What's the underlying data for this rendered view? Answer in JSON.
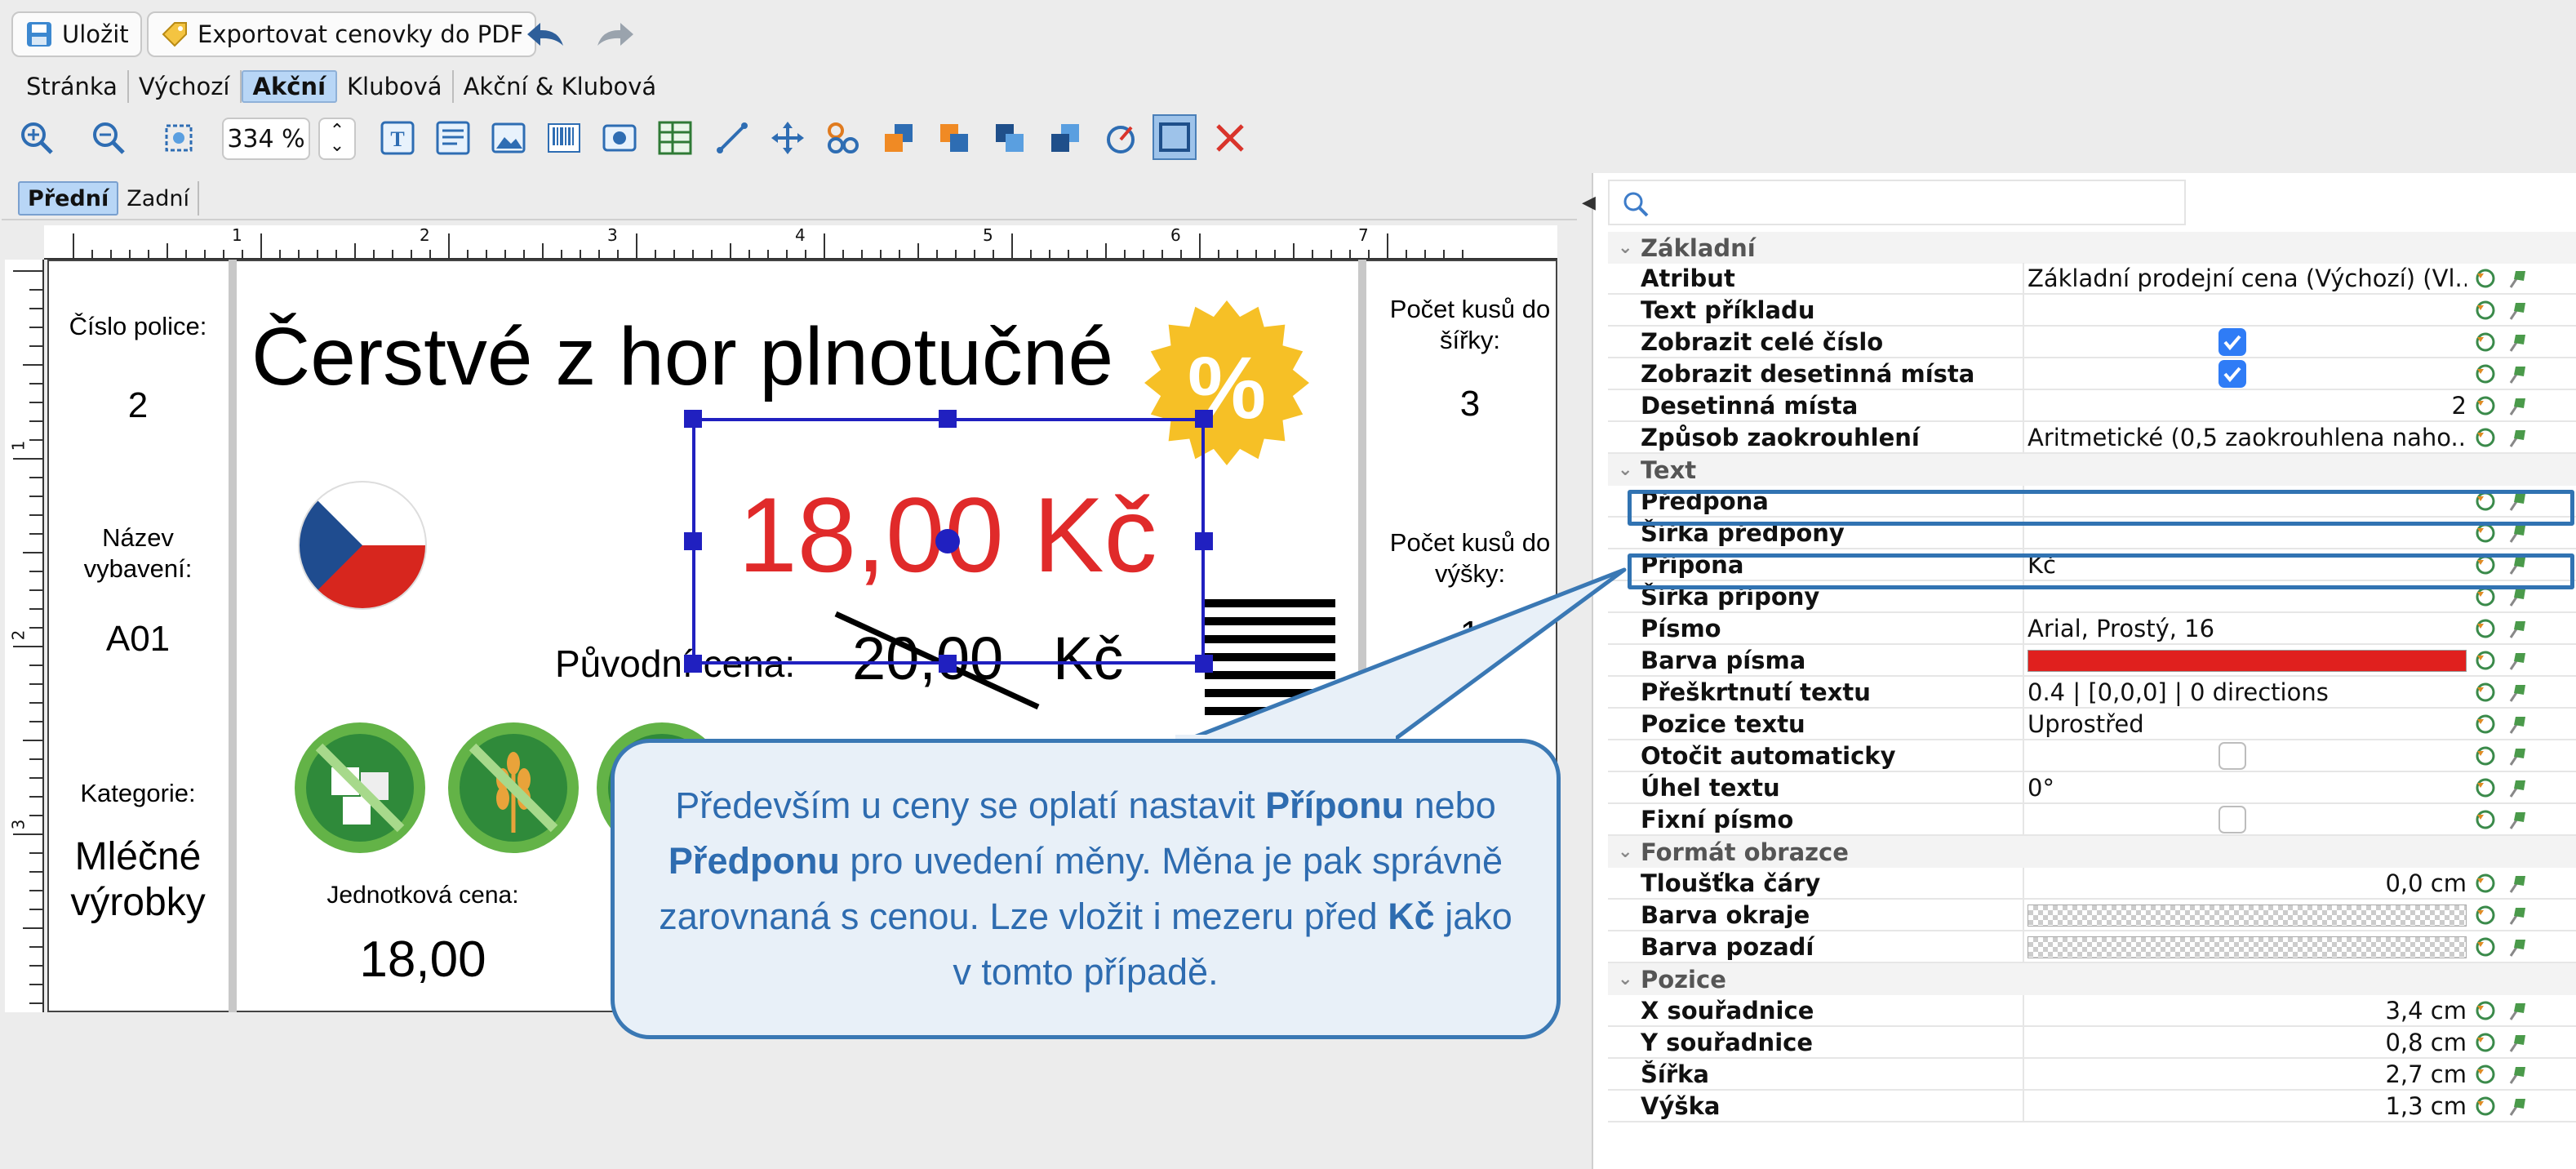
{
  "toolbar": {
    "save_label": "Uložit",
    "export_label": "Exportovat cenovky do PDF",
    "zoom_value": "334 %"
  },
  "tabs": [
    "Stránka",
    "Výchozí",
    "Akční",
    "Klubová",
    "Akční & Klubová"
  ],
  "active_tab": "Akční",
  "subtabs": [
    "Přední",
    "Zadní"
  ],
  "ruler": {
    "top_marks": [
      "1",
      "2",
      "3",
      "4",
      "5",
      "6",
      "7"
    ],
    "left_marks": [
      "1",
      "2",
      "3"
    ]
  },
  "label": {
    "shelf_label": "Číslo police:",
    "shelf_value": "2",
    "equipment_label": "Název vybavení:",
    "equipment_value": "A01",
    "category_label": "Kategorie:",
    "category_value": "Mléčné výrobky",
    "title": "Čerstvé z hor plnotučné",
    "badge": "%",
    "price": "18,00 Kč",
    "original_label": "Původní cena:",
    "original_value": "20,00",
    "original_currency": "Kč",
    "unit_label": "Jednotková cena:",
    "unit_value": "18,00",
    "width_count_label": "Počet kusů do šířky:",
    "width_count_value": "3",
    "height_count_label": "Počet kusů do výšky:",
    "height_count_value": "1"
  },
  "callout": {
    "t1": "Především u ceny se oplatí nastavit ",
    "b1": "Příponu",
    "t2": " nebo ",
    "b2": "Předponu",
    "t3": " pro uvedení měny. Měna je pak správně zarovnaná s cenou. Lze vložit i mezeru před ",
    "b3": "Kč",
    "t4": " jako v tomto případě."
  },
  "properties": {
    "sections": {
      "basic": "Základní",
      "text": "Text",
      "format": "Formát obrazce",
      "position": "Pozice"
    },
    "rows": {
      "attribute": {
        "key": "Atribut",
        "value": "Základní prodejní cena (Výchozí) (Vl..."
      },
      "sample": {
        "key": "Text příkladu",
        "value": ""
      },
      "whole": {
        "key": "Zobrazit celé číslo",
        "checked": true
      },
      "decimals_show": {
        "key": "Zobrazit desetinná místa",
        "checked": true
      },
      "decimals": {
        "key": "Desetinná místa",
        "value": "2"
      },
      "rounding": {
        "key": "Způsob zaokrouhlení",
        "value": "Aritmetické (0,5 zaokrouhlena naho..."
      },
      "prefix": {
        "key": "Předpona",
        "value": ""
      },
      "prefix_width": {
        "key": "Šířka předpony",
        "value": ""
      },
      "suffix": {
        "key": "Přípona",
        "value": " Kč"
      },
      "suffix_width": {
        "key": "Šířka přípony",
        "value": ""
      },
      "font": {
        "key": "Písmo",
        "value": "Arial, Prostý, 16"
      },
      "font_color": {
        "key": "Barva písma",
        "color": "#e0201e"
      },
      "strike": {
        "key": "Přeškrtnutí textu",
        "value": "0.4 | [0,0,0] | 0 directions"
      },
      "text_pos": {
        "key": "Pozice textu",
        "value": "Uprostřed"
      },
      "auto_rotate": {
        "key": "Otočit automaticky",
        "checked": false
      },
      "angle": {
        "key": "Úhel textu",
        "value": "0°"
      },
      "fixed_font": {
        "key": "Fixní písmo",
        "checked": false
      },
      "line_width": {
        "key": "Tloušťka čáry",
        "value": "0,0 cm"
      },
      "border_color": {
        "key": "Barva okraje",
        "value": ""
      },
      "bg_color": {
        "key": "Barva pozadí",
        "value": ""
      },
      "x": {
        "key": "X souřadnice",
        "value": "3,4 cm"
      },
      "y": {
        "key": "Y souřadnice",
        "value": "0,8 cm"
      },
      "w": {
        "key": "Šířka",
        "value": "2,7 cm"
      },
      "h": {
        "key": "Výška",
        "value": "1,3 cm"
      }
    }
  },
  "colors": {
    "accent": "#3173b2",
    "price_red": "#e02a2a",
    "badge_yellow": "#f6c026",
    "diet_green": "#63b347"
  },
  "icons": [
    "zoom-in-icon",
    "zoom-out-icon",
    "fit-icon",
    "text-tool-icon",
    "paragraph-tool-icon",
    "image-tool-icon",
    "barcode-tool-icon",
    "photo-tool-icon",
    "table-tool-icon",
    "line-tool-icon",
    "move-icon",
    "group-icon",
    "bring-front-icon",
    "send-back-icon",
    "bring-forward-icon",
    "send-backward-icon",
    "rotate-icon",
    "frame-icon",
    "delete-icon",
    "search-icon",
    "reset-icon",
    "pin-icon"
  ]
}
